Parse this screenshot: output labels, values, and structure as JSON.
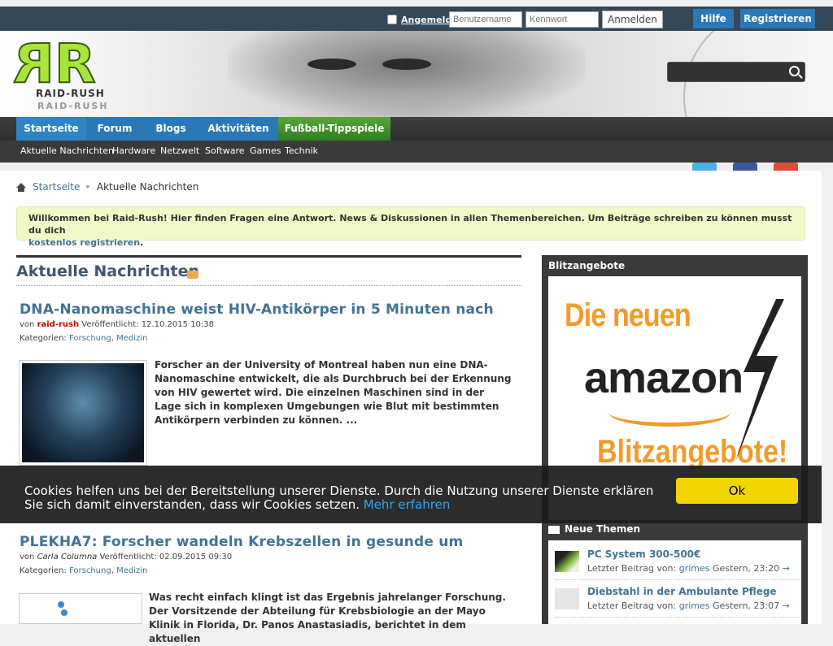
{
  "topbar": {
    "remember_label": "Angemeldet bleiben",
    "username_placeholder": "Benutzername",
    "password_placeholder": "Kennwort",
    "login_button": "Anmelden",
    "help_button": "Hilfe",
    "register_button": "Registrieren"
  },
  "logo": {
    "text1": "RAID-RUSH",
    "text2": "RAID-RUSH"
  },
  "nav": {
    "tabs": [
      "Startseite",
      "Forum",
      "Blogs",
      "Aktivitäten",
      "Fußball-Tippspiele"
    ],
    "subitems": [
      "Aktuelle Nachrichten",
      "Hardware",
      "Netzwelt",
      "Software",
      "Games",
      "Technik"
    ]
  },
  "breadcrumb": {
    "home": "Startseite",
    "current": "Aktuelle Nachrichten"
  },
  "notice": {
    "text": "Willkommen bei Raid-Rush! Hier finden Fragen eine Antwort. News & Diskussionen in allen Themenbereichen. Um Beiträge schreiben zu können musst du dich",
    "link": "kostenlos registrieren",
    "end": "."
  },
  "section": {
    "title": "Aktuelle Nachrichten",
    "rss": "RSS"
  },
  "articles": [
    {
      "title": "DNA-Nanomaschine weist HIV-Antikörper in 5 Minuten nach",
      "by": "von",
      "author": "raid-rush",
      "published_label": "Veröffentlicht:",
      "published": "12.10.2015 10:38",
      "categories_label": "Kategorien:",
      "cat1": "Forschung",
      "cat2": "Medizin",
      "excerpt": "Forscher an der University of Montreal haben nun eine DNA-Nanomaschine entwickelt, die als Durchbruch bei der Erkennung von HIV gewertet wird. Die einzelnen Maschinen sind in der Lage sich in komplexen Umgebungen wie Blut mit bestimmten Antikörpern verbinden zu können. ..."
    },
    {
      "title": "PLEKHA7: Forscher wandeln Krebszellen in gesunde um",
      "by": "von",
      "author": "Carla Columna",
      "published_label": "Veröffentlicht:",
      "published": "02.09.2015 09:30",
      "categories_label": "Kategorien:",
      "cat1": "Forschung",
      "cat2": "Medizin",
      "excerpt": "Was recht einfach klingt ist das Ergebnis jahrelanger Forschung. Der Vorsitzende der Abteilung für Krebsbiologie an der Mayo Klinik in Florida, Dr. Panos Anastasiadis, berichtet in dem aktuellen"
    }
  ],
  "sidebar": {
    "blitz_title": "Blitzangebote",
    "ad_line1": "Die neuen",
    "ad_line2": "amazon",
    "ad_line3": "Blitzangebote!",
    "new_topics_title": "Neue Themen",
    "topics": [
      {
        "title": "PC System 300-500€",
        "prefix": "Letzter Beitrag von:",
        "user": "grimes",
        "time": "Gestern, 23:20",
        "arrow": "→"
      },
      {
        "title": "Diebstahl in der Ambulante Pflege",
        "prefix": "Letzter Beitrag von:",
        "user": "grimes",
        "time": "Gestern, 23:07",
        "arrow": "→"
      }
    ]
  },
  "cookie": {
    "text": "Cookies helfen uns bei der Bereitstellung unserer Dienste. Durch die Nutzung unserer Dienste erklären Sie sich damit einverstanden, dass wir Cookies setzen.",
    "link": "Mehr erfahren",
    "ok": "Ok"
  },
  "colors": {
    "accent": "#2a79b6",
    "link": "#417394",
    "cookie_ok": "#f1d600",
    "notice_bg": "#f1f9c9"
  }
}
